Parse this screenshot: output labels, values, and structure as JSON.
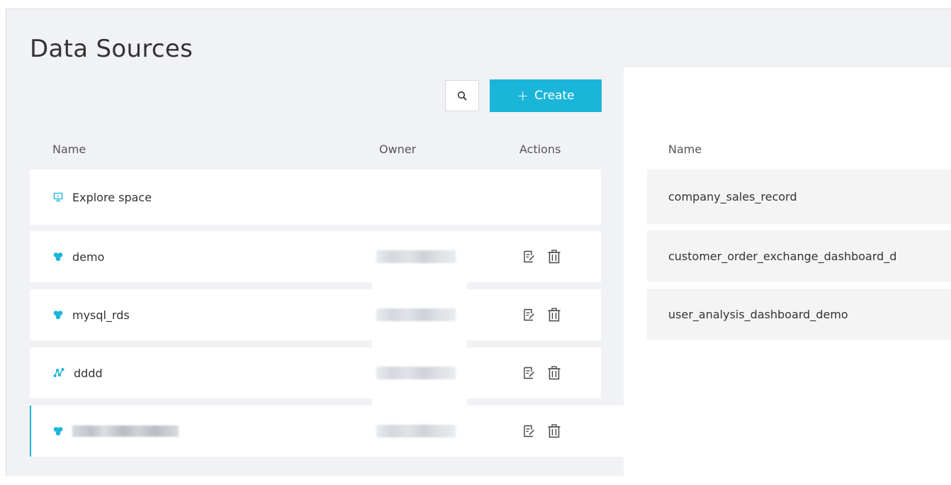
{
  "page": {
    "title": "Data Sources"
  },
  "toolbar": {
    "create_label": "Create",
    "create_icon": "plus-icon",
    "search_icon": "search-icon"
  },
  "table": {
    "columns": {
      "name": "Name",
      "owner": "Owner",
      "actions": "Actions"
    },
    "rows": [
      {
        "name": "Explore space",
        "icon": "monitor-icon",
        "owner": "",
        "actions": []
      },
      {
        "name": "demo",
        "icon": "cluster-icon",
        "owner": "(blurred)",
        "actions": [
          "edit-icon",
          "delete-icon"
        ]
      },
      {
        "name": "mysql_rds",
        "icon": "cluster-icon",
        "owner": "(blurred)",
        "actions": [
          "edit-icon",
          "delete-icon"
        ]
      },
      {
        "name": "dddd",
        "icon": "graph-icon",
        "owner": "(blurred)",
        "actions": [
          "edit-icon",
          "delete-icon"
        ]
      },
      {
        "name": "(blurred)",
        "icon": "cluster-icon",
        "owner": "(blurred)",
        "actions": [
          "edit-icon",
          "delete-icon"
        ],
        "active": true
      }
    ]
  },
  "detail_panel": {
    "column_name": "Name",
    "items": [
      "company_sales_record",
      "customer_order_exchange_dashboard_d",
      "user_analysis_dashboard_demo"
    ]
  },
  "colors": {
    "accent": "#1ab5d8",
    "background": "#f1f2f5",
    "row_background": "#ffffff",
    "panel_row_background": "#f4f4f5"
  }
}
